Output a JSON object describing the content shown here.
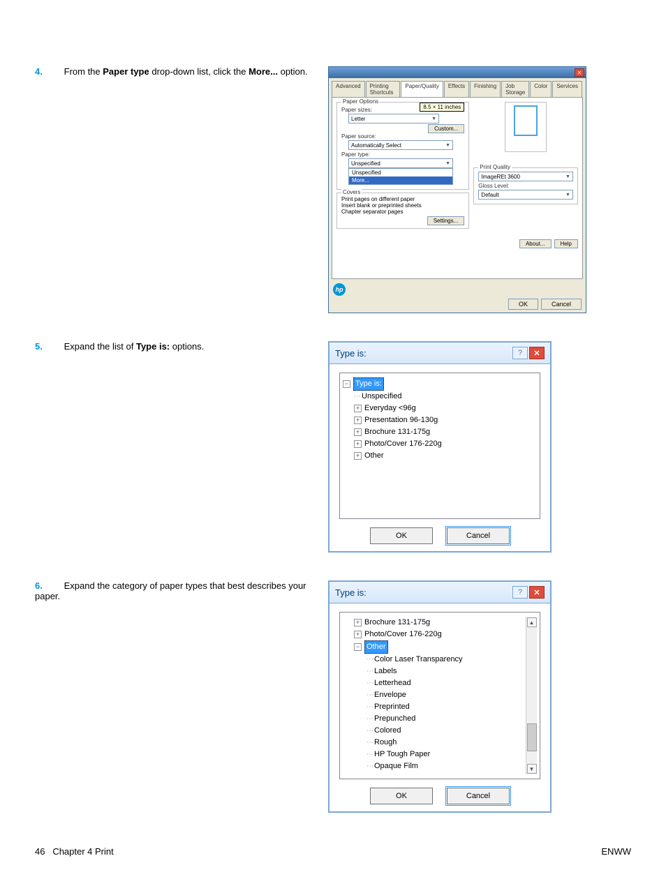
{
  "steps": {
    "s4": {
      "num": "4.",
      "text_a": "From the ",
      "bold_a": "Paper type",
      "text_b": " drop-down list, click the ",
      "bold_b": "More...",
      "text_c": " option."
    },
    "s5": {
      "num": "5.",
      "text_a": "Expand the list of ",
      "bold_a": "Type is:",
      "text_b": " options."
    },
    "s6": {
      "num": "6.",
      "text_a": "Expand the category of paper types that best describes your paper."
    }
  },
  "dlg1": {
    "tabs": [
      "Advanced",
      "Printing Shortcuts",
      "Paper/Quality",
      "Effects",
      "Finishing",
      "Job Storage",
      "Color",
      "Services"
    ],
    "active_tab": 2,
    "paper_options_title": "Paper Options",
    "paper_sizes_label": "Paper sizes:",
    "size_tooltip": "8.5 × 11 inches",
    "size_value": "Letter",
    "custom_btn": "Custom...",
    "paper_source_label": "Paper source:",
    "paper_source_value": "Automatically Select",
    "paper_type_label": "Paper type:",
    "paper_type_value": "Unspecified",
    "dd_items": [
      "Unspecified",
      "More..."
    ],
    "special_title": "Covers",
    "special_items": [
      "Print pages on different paper",
      "Insert blank or preprinted sheets",
      "Chapter separator pages"
    ],
    "settings_btn": "Settings...",
    "print_quality_title": "Print Quality",
    "pq_value": "ImageREt 3600",
    "gloss_label": "Gloss Level:",
    "gloss_value": "Default",
    "about_btn": "About...",
    "help_btn": "Help",
    "ok_btn": "OK",
    "cancel_btn": "Cancel"
  },
  "dlg2": {
    "title": "Type is:",
    "root": "Type is:",
    "items": [
      "Unspecified",
      "Everyday <96g",
      "Presentation 96-130g",
      "Brochure 131-175g",
      "Photo/Cover 176-220g",
      "Other"
    ],
    "ok": "OK",
    "cancel": "Cancel"
  },
  "dlg3": {
    "title": "Type is:",
    "top": [
      "Brochure 131-175g",
      "Photo/Cover 176-220g"
    ],
    "hl": "Other",
    "children": [
      "Color Laser Transparency",
      "Labels",
      "Letterhead",
      "Envelope",
      "Preprinted",
      "Prepunched",
      "Colored",
      "Rough",
      "HP Tough Paper",
      "Opaque Film"
    ],
    "ok": "OK",
    "cancel": "Cancel"
  },
  "footer": {
    "page": "46",
    "chapter": "Chapter 4   Print",
    "right": "ENWW"
  }
}
